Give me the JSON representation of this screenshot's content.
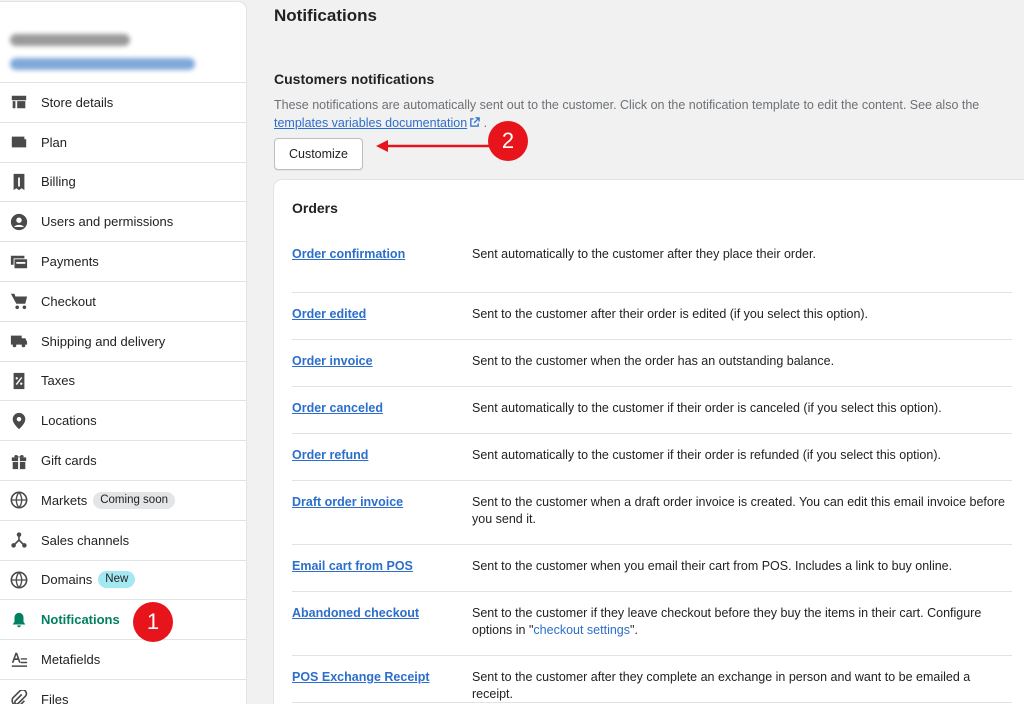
{
  "sidebar": {
    "items": [
      {
        "label": "Store details",
        "icon": "store-icon"
      },
      {
        "label": "Plan",
        "icon": "wallet-icon"
      },
      {
        "label": "Billing",
        "icon": "receipt-icon"
      },
      {
        "label": "Users and permissions",
        "icon": "user-icon"
      },
      {
        "label": "Payments",
        "icon": "card-icon"
      },
      {
        "label": "Checkout",
        "icon": "cart-icon"
      },
      {
        "label": "Shipping and delivery",
        "icon": "truck-icon"
      },
      {
        "label": "Taxes",
        "icon": "tax-icon"
      },
      {
        "label": "Locations",
        "icon": "pin-icon"
      },
      {
        "label": "Gift cards",
        "icon": "gift-icon"
      },
      {
        "label": "Markets",
        "icon": "globe-icon",
        "badge": "Coming soon"
      },
      {
        "label": "Sales channels",
        "icon": "channels-icon"
      },
      {
        "label": "Domains",
        "icon": "globe-icon",
        "badge": "New"
      },
      {
        "label": "Notifications",
        "icon": "bell-icon",
        "active": true
      },
      {
        "label": "Metafields",
        "icon": "metafields-icon"
      },
      {
        "label": "Files",
        "icon": "paperclip-icon"
      }
    ]
  },
  "markers": {
    "one": "1",
    "two": "2"
  },
  "main": {
    "title": "Notifications",
    "section_title": "Customers notifications",
    "section_desc": "These notifications are automatically sent out to the customer. Click on the notification template to edit the content. See also the",
    "docs_link": "templates variables documentation",
    "docs_after": ".",
    "customize_label": "Customize"
  },
  "orders": {
    "title": "Orders",
    "rows": [
      {
        "name": "Order confirmation",
        "desc": "Sent automatically to the customer after they place their order."
      },
      {
        "name": "Order edited",
        "desc": "Sent to the customer after their order is edited (if you select this option)."
      },
      {
        "name": "Order invoice",
        "desc": "Sent to the customer when the order has an outstanding balance."
      },
      {
        "name": "Order canceled",
        "desc": "Sent automatically to the customer if their order is canceled (if you select this option)."
      },
      {
        "name": "Order refund",
        "desc": "Sent automatically to the customer if their order is refunded (if you select this option)."
      },
      {
        "name": "Draft order invoice",
        "desc": "Sent to the customer when a draft order invoice is created. You can edit this email invoice before you send it."
      },
      {
        "name": "Email cart from POS",
        "desc": "Sent to the customer when you email their cart from POS. Includes a link to buy online."
      },
      {
        "name": "Abandoned checkout",
        "desc": "Sent to the customer if they leave checkout before they buy the items in their cart. Configure options in \"",
        "link": "checkout settings",
        "desc_after": "\"."
      },
      {
        "name": "POS Exchange Receipt",
        "desc": "Sent to the customer after they complete an exchange in person and want to be emailed a receipt."
      }
    ]
  },
  "colors": {
    "accent": "#008060",
    "link": "#2c6ecb",
    "marker": "#e8141b"
  }
}
